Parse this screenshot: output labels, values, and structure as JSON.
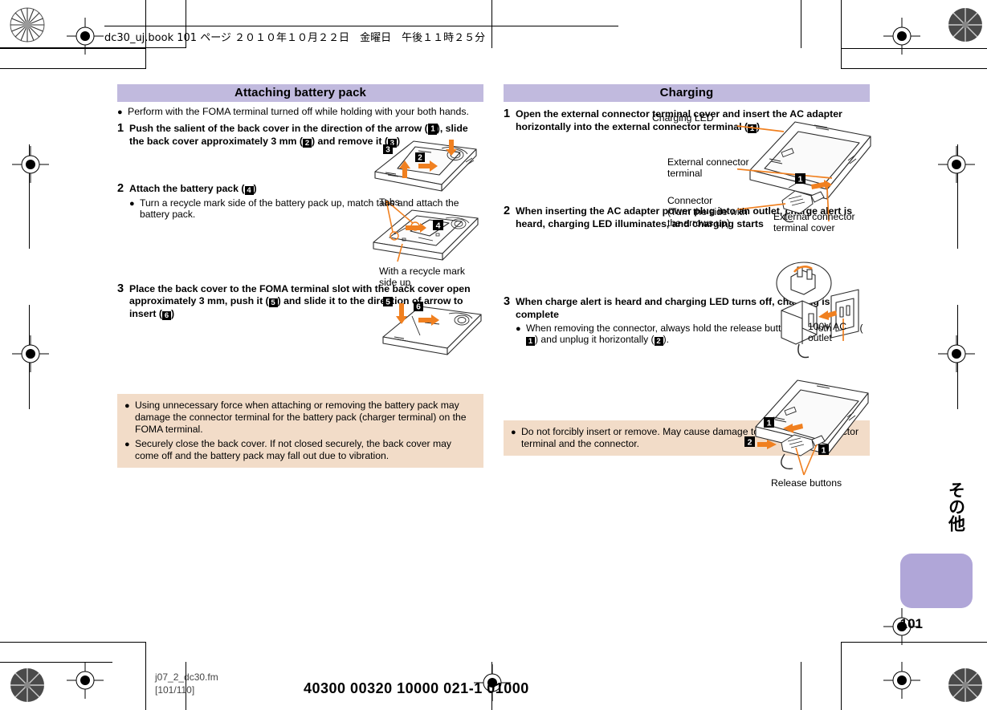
{
  "header": {
    "book_line": "dc30_uj.book   101 ページ  ２０１０年１０月２２日　金曜日　午後１１時２５分"
  },
  "left_column": {
    "heading": "Attaching battery pack",
    "intro_bullet": "Perform with the FOMA terminal turned off while holding with your both hands.",
    "steps": [
      {
        "num": "1",
        "title_parts": [
          "Push the salient of the back cover in the direction of the arrow (",
          "1",
          "), slide the back cover approximately 3 mm (",
          "2",
          ") and remove it (",
          "3",
          ")"
        ],
        "sub": []
      },
      {
        "num": "2",
        "title_parts": [
          "Attach the battery pack (",
          "4",
          ")"
        ],
        "sub": [
          "Turn a recycle mark side of the battery pack up, match tabs and attach the battery pack."
        ]
      },
      {
        "num": "3",
        "title_parts": [
          "Place the back cover to the FOMA terminal slot with the back cover open approximately 3 mm, push it (",
          "5",
          ") and slide it to the direction of arrow to insert (",
          "6",
          ")"
        ],
        "sub": []
      }
    ],
    "figure_labels": {
      "tabs": "Tabs",
      "recycle": "With a recycle mark\nside up"
    },
    "note": [
      "Using unnecessary force when attaching or removing the battery pack may damage the connector terminal for the battery pack (charger terminal) on the FOMA terminal.",
      "Securely close the back cover. If not closed securely, the back cover may come off and the battery pack may fall out due to vibration."
    ]
  },
  "right_column": {
    "heading": "Charging",
    "steps": [
      {
        "num": "1",
        "title_parts": [
          "Open the external connector terminal cover and insert the AC adapter horizontally into the external connector terminal (",
          "1",
          ")"
        ],
        "sub": []
      },
      {
        "num": "2",
        "title_parts": [
          "When inserting the AC adapter power plug into an outlet, charge alert is heard, charging LED illuminates, and charging starts"
        ],
        "sub": []
      },
      {
        "num": "3",
        "title_parts": [
          "When charge alert is heard and charging LED turns off, charging is complete"
        ],
        "sub_parts": [
          "When removing the connector, always hold the release buttons on both sides (",
          "1",
          ") and unplug it horizontally (",
          "2",
          ")."
        ]
      }
    ],
    "figure_labels": {
      "charging_led": "Charging LED",
      "external_connector_terminal": "External connector\nterminal",
      "connector": "Connector\n(Turn the side with\nthe arrows up)",
      "external_connector_terminal_cover": "External connector\nterminal cover",
      "ac_outlet": "100V AC\noutlet",
      "release_buttons": "Release buttons"
    },
    "note": [
      "Do not forcibly insert or remove. May cause damage to the external connector terminal and the connector."
    ]
  },
  "side_tab": {
    "label": "その他",
    "page_number": "101"
  },
  "footer": {
    "file_name": "j07_2_dc30.fm",
    "page_range": "[101/110]",
    "print_code": "40300  00320  10000  021-1  01000"
  },
  "colors": {
    "heading_bar": "#c1bade",
    "note_bg": "#f2dcc8",
    "tab_box": "#b0a6d8",
    "arrow_orange": "#f08020"
  }
}
